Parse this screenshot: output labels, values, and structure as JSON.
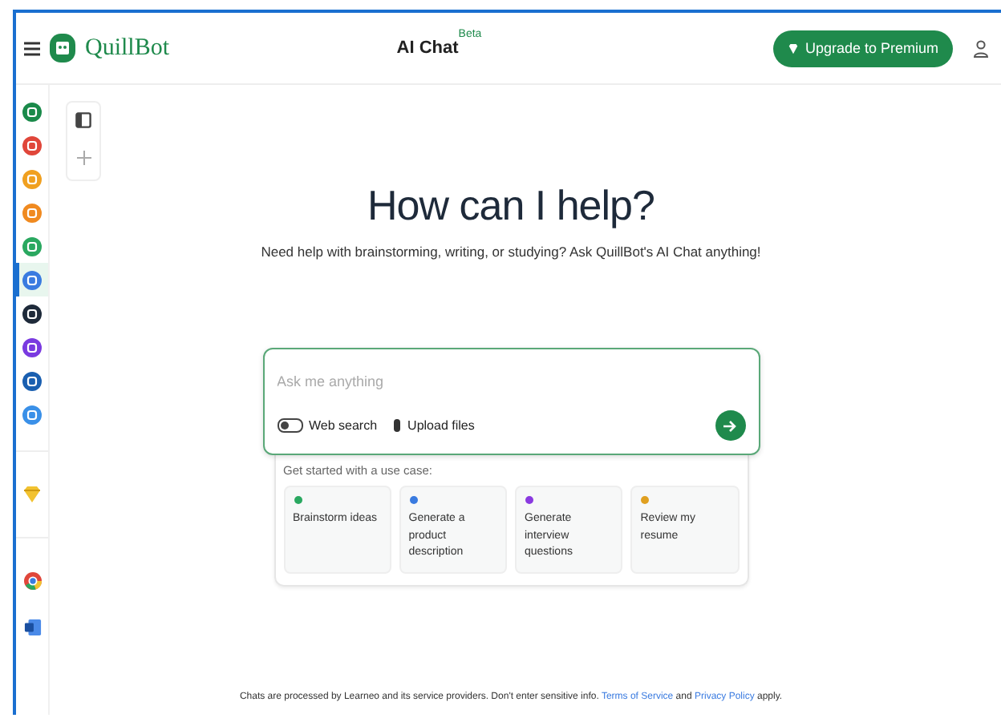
{
  "header": {
    "brand": "QuillBot",
    "title": "AI Chat",
    "badge": "Beta",
    "upgrade_button": "Upgrade to Premium"
  },
  "tools": [
    {
      "color": "#1a8a4a",
      "selected": false
    },
    {
      "color": "#e0463a",
      "selected": false
    },
    {
      "color": "#f0a020",
      "selected": false
    },
    {
      "color": "#f08a20",
      "selected": false
    },
    {
      "color": "#2aa860",
      "selected": false
    },
    {
      "color": "#3a7be0",
      "selected": true
    },
    {
      "color": "#1e2a3a",
      "selected": false
    },
    {
      "color": "#7a3ae0",
      "selected": false
    },
    {
      "color": "#1a5fb0",
      "selected": false
    },
    {
      "color": "#3a90e8",
      "selected": false
    }
  ],
  "heading": "How can I help?",
  "subheading": "Need help with brainstorming, writing, or studying? Ask QuillBot's AI Chat anything!",
  "composer": {
    "placeholder": "Ask me anything",
    "web_search": {
      "label": "Web search",
      "on": false
    },
    "upload": "Upload files"
  },
  "use_cases": {
    "label": "Get started with a use case:",
    "items": [
      {
        "text": "Brainstorm ideas",
        "color": "#2aa860"
      },
      {
        "text": "Generate a product description",
        "color": "#3a7be0"
      },
      {
        "text": "Generate interview questions",
        "color": "#8a3ae0"
      },
      {
        "text": "Review my resume",
        "color": "#e0a020"
      }
    ]
  },
  "footer": {
    "text": "Chats are processed by Learneo and its service providers. Don't enter sensitive info.",
    "terms": "Terms of Service",
    "and": "and",
    "privacy": "Privacy Policy",
    "apply": "apply."
  }
}
